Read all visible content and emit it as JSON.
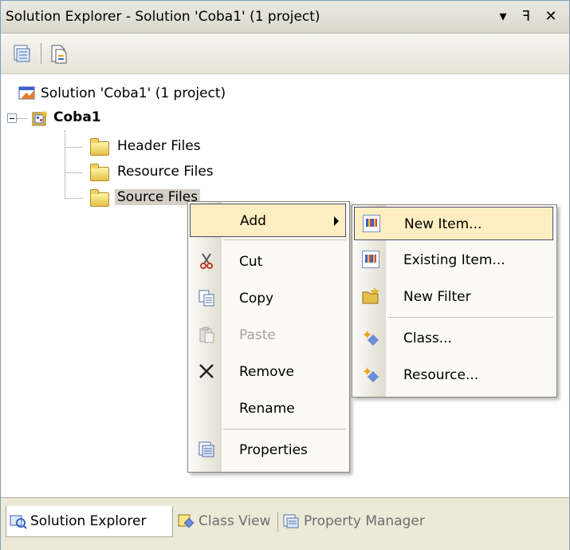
{
  "window": {
    "title": "Solution Explorer - Solution 'Coba1' (1 project)",
    "buttons": [
      "▾",
      "ꟻ",
      "✕"
    ]
  },
  "tree": {
    "solution_label": "Solution 'Coba1' (1 project)",
    "project_label": "Coba1",
    "folders": [
      "Header Files",
      "Resource Files",
      "Source Files"
    ]
  },
  "context_menu": {
    "items": [
      {
        "label": "Add",
        "icon": "none",
        "submenu": true,
        "highlighted": true
      },
      {
        "label": "Cut",
        "icon": "scissors-icon"
      },
      {
        "label": "Copy",
        "icon": "copy-icon"
      },
      {
        "label": "Paste",
        "icon": "paste-icon",
        "disabled": true
      },
      {
        "label": "Remove",
        "icon": "remove-x-icon"
      },
      {
        "label": "Rename",
        "icon": "none"
      },
      {
        "label": "Properties",
        "icon": "properties-icon"
      }
    ]
  },
  "submenu": {
    "items": [
      {
        "label": "New Item...",
        "icon": "new-item-icon",
        "highlighted": true
      },
      {
        "label": "Existing Item...",
        "icon": "existing-item-icon"
      },
      {
        "label": "New Filter",
        "icon": "new-filter-icon"
      },
      {
        "label": "Class...",
        "icon": "class-icon"
      },
      {
        "label": "Resource...",
        "icon": "resource-icon"
      }
    ]
  },
  "tabs": [
    {
      "label": "Solution Explorer",
      "active": true
    },
    {
      "label": "Class View",
      "active": false
    },
    {
      "label": "Property Manager",
      "active": false
    }
  ],
  "colors": {
    "menu_highlight": "#ffeec2",
    "menu_highlight_border": "#4b4b6f",
    "folder_yellow": "#e6c04a"
  }
}
